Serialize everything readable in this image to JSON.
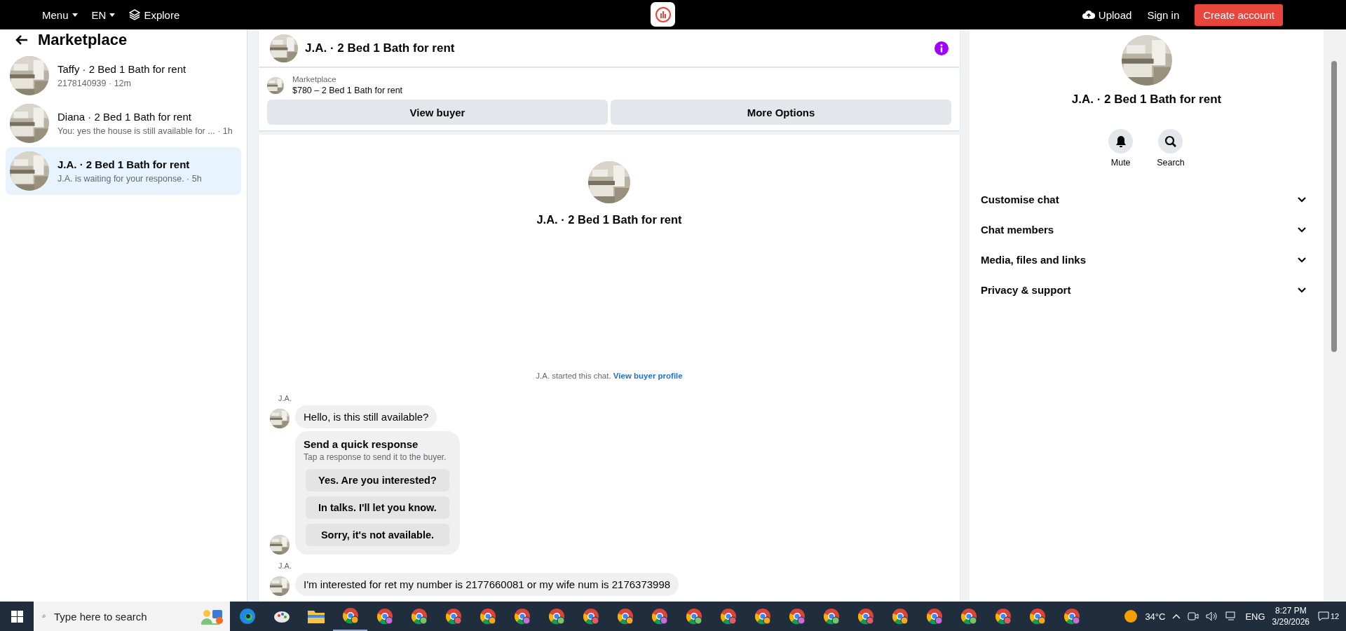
{
  "topbar": {
    "menu": "Menu",
    "language": "EN",
    "explore": "Explore",
    "upload": "Upload",
    "sign_in": "Sign in",
    "create_account": "Create account"
  },
  "sidebar": {
    "title": "Marketplace",
    "conversations": [
      {
        "title": "Taffy · 2 Bed 1 Bath for rent",
        "preview": "2178140939 · 12m",
        "selected": false
      },
      {
        "title": "Diana · 2 Bed 1 Bath for rent",
        "preview": "You: yes the house is still available for ... · 1h",
        "selected": false
      },
      {
        "title": "J.A. · 2 Bed 1 Bath for rent",
        "preview": "J.A. is waiting for your response. · 5h",
        "selected": true
      }
    ]
  },
  "chat": {
    "title": "J.A. · 2 Bed 1 Bath for rent",
    "listing": {
      "source": "Marketplace",
      "title": "$780 – 2 Bed 1 Bath for rent"
    },
    "buttons": [
      "View buyer",
      "More Options"
    ],
    "intro_title": "J.A. · 2 Bed 1 Bath for rent",
    "started_note": "J.A. started this chat.",
    "profile_link": "View buyer profile",
    "messages": [
      {
        "kind": "text",
        "sender": "J.A.",
        "text": "Hello, is this still available?"
      },
      {
        "kind": "quick",
        "title": "Send a quick response",
        "subtitle": "Tap a response to send it to the buyer.",
        "options": [
          "Yes. Are you interested?",
          "In talks. I'll let you know.",
          "Sorry, it's not available."
        ]
      },
      {
        "kind": "text",
        "sender": "J.A.",
        "text": "I'm interested for ret my number is 2177660081 or my wife num is 2176373998"
      }
    ]
  },
  "details": {
    "title": "J.A. · 2 Bed 1 Bath for rent",
    "actions": [
      {
        "kind": "bell",
        "label": "Mute"
      },
      {
        "kind": "search",
        "label": "Search"
      }
    ],
    "sections": [
      {
        "label": "Customise chat",
        "expanded": false
      },
      {
        "label": "Chat members",
        "expanded": false
      },
      {
        "label": "Media, files and links",
        "expanded": false
      },
      {
        "label": "Privacy & support",
        "expanded": false
      }
    ]
  },
  "taskbar": {
    "search_placeholder": "Type here to search",
    "temperature": "34°C",
    "language": "ENG",
    "time": "8:27 PM",
    "date": "3/29/2026",
    "notifications": "12"
  }
}
